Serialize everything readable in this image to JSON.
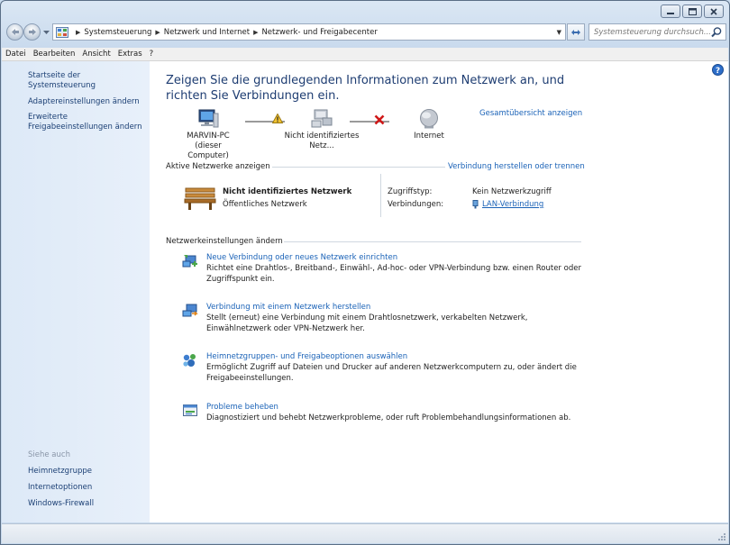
{
  "window": {
    "caption": {
      "minimize": "minimize",
      "maximize": "maximize",
      "close": "close"
    }
  },
  "address": {
    "crumbs": [
      "Systemsteuerung",
      "Netzwerk und Internet",
      "Netzwerk- und Freigabecenter"
    ],
    "search_placeholder": "Systemsteuerung durchsuch..."
  },
  "menu": [
    "Datei",
    "Bearbeiten",
    "Ansicht",
    "Extras",
    "?"
  ],
  "sidebar": {
    "home": "Startseite der Systemsteuerung",
    "links": [
      "Adaptereinstellungen ändern",
      "Erweiterte Freigabeeinstellungen ändern"
    ],
    "see_also": "Siehe auch",
    "see_also_links": [
      "Heimnetzgruppe",
      "Internetoptionen",
      "Windows-Firewall"
    ]
  },
  "main": {
    "title": "Zeigen Sie die grundlegenden Informationen zum Netzwerk an, und richten Sie Verbindungen ein.",
    "full_map_link": "Gesamtübersicht anzeigen",
    "nodes": {
      "computer_name": "MARVIN-PC",
      "computer_sub": "(dieser Computer)",
      "network": "Nicht identifiziertes Netz...",
      "internet": "Internet"
    },
    "active": {
      "header": "Aktive Netzwerke anzeigen",
      "connect_link": "Verbindung herstellen oder trennen",
      "network_name": "Nicht identifiziertes Netzwerk",
      "network_type": "Öffentliches Netzwerk",
      "access_label": "Zugriffstyp:",
      "access_value": "Kein Netzwerkzugriff",
      "connections_label": "Verbindungen:",
      "connections_value": "LAN-Verbindung"
    },
    "settings_header": "Netzwerkeinstellungen ändern",
    "tasks": [
      {
        "link": "Neue Verbindung oder neues Netzwerk einrichten",
        "desc": "Richtet eine Drahtlos-, Breitband-, Einwähl-, Ad-hoc- oder VPN-Verbindung bzw. einen Router oder Zugriffspunkt ein."
      },
      {
        "link": "Verbindung mit einem Netzwerk herstellen",
        "desc": "Stellt (erneut) eine Verbindung mit einem Drahtlosnetzwerk, verkabelten Netzwerk, Einwählnetzwerk oder VPN-Netzwerk her."
      },
      {
        "link": "Heimnetzgruppen- und Freigabeoptionen auswählen",
        "desc": "Ermöglicht Zugriff auf Dateien und Drucker auf anderen Netzwerkcomputern zu, oder ändert die Freigabeeinstellungen."
      },
      {
        "link": "Probleme beheben",
        "desc": "Diagnostiziert und behebt Netzwerkprobleme, oder ruft Problembehandlungsinformationen ab."
      }
    ]
  }
}
